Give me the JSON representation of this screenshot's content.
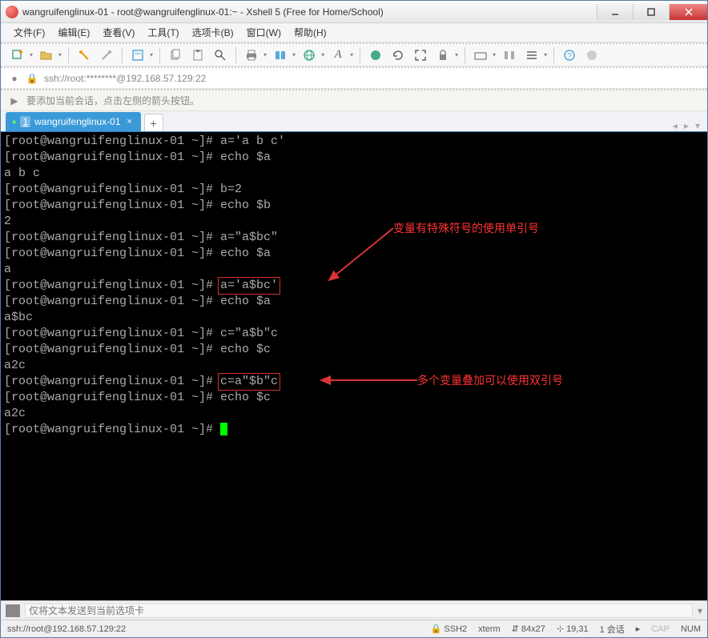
{
  "window": {
    "title": "wangruifenglinux-01 - root@wangruifenglinux-01:~ - Xshell 5 (Free for Home/School)"
  },
  "menu": {
    "file": "文件(F)",
    "edit": "编辑(E)",
    "view": "查看(V)",
    "tools": "工具(T)",
    "tab": "选项卡(B)",
    "window": "窗口(W)",
    "help": "帮助(H)"
  },
  "address": {
    "text": "ssh://root:********@192.168.57.129:22"
  },
  "hint": {
    "text": "要添加当前会话，点击左侧的箭头按钮。"
  },
  "tab": {
    "num": "1",
    "label": "wangruifenglinux-01"
  },
  "terminal": {
    "prompt": "[root@wangruifenglinux-01 ~]# ",
    "lines": {
      "l1_cmd": "a='a b c'",
      "l2_cmd": "echo $a",
      "l3": "a b c",
      "l4_cmd": "b=2",
      "l5_cmd": "echo $b",
      "l6": "2",
      "l7_cmd": "a=\"a$bc\"",
      "l8_cmd": "echo $a",
      "l9": "a",
      "l10_cmd": "a='a$bc'",
      "l11_cmd": "echo $a",
      "l12": "a$bc",
      "l13_cmd": "c=\"a$b\"c",
      "l14_cmd": "echo $c",
      "l15": "a2c",
      "l16_cmd": "c=a\"$b\"c",
      "l17_cmd": "echo $c",
      "l18": "a2c"
    },
    "annot1": "变量有特殊符号的使用单引号",
    "annot2": "多个变量叠加可以使用双引号"
  },
  "sendbar": {
    "placeholder": "仅将文本发送到当前选项卡"
  },
  "status": {
    "left": "ssh://root@192.168.57.129:22",
    "ssh": "SSH2",
    "term": "xterm",
    "size": "84x27",
    "pos": "19,31",
    "sessions": "1 会话",
    "cap": "CAP",
    "num": "NUM"
  }
}
